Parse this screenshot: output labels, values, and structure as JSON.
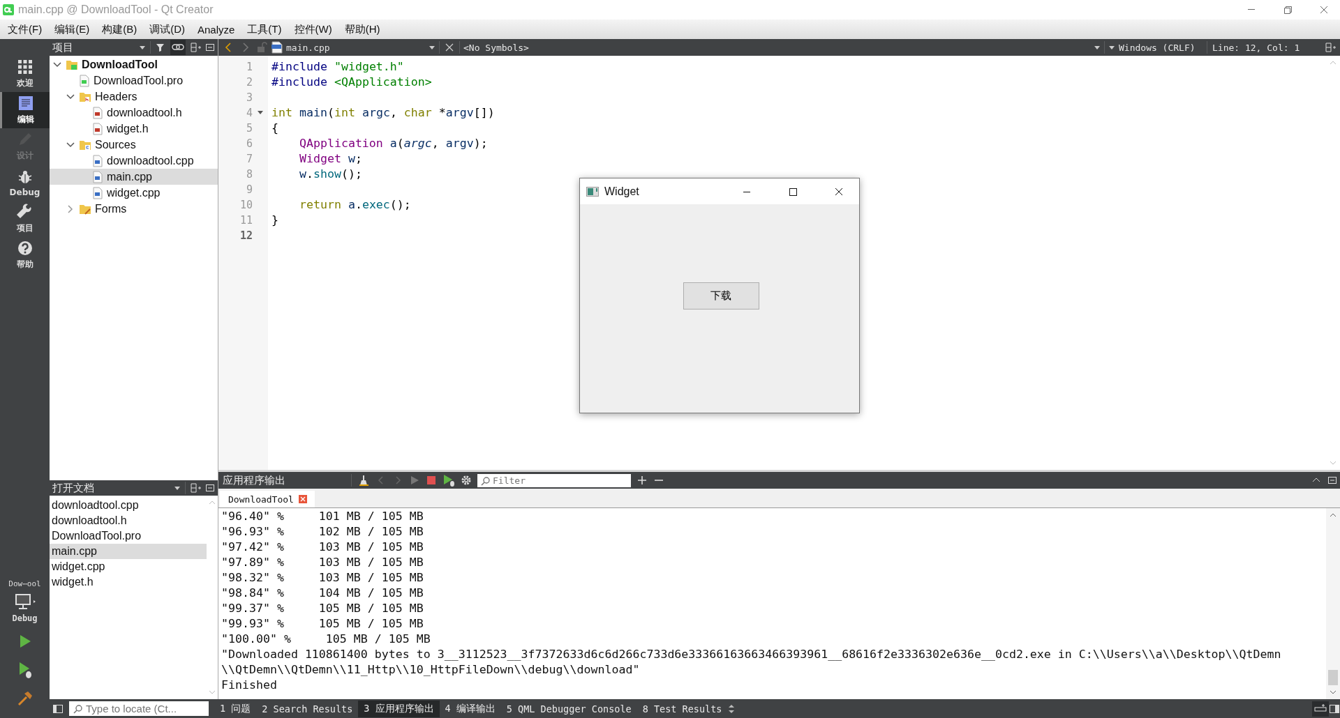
{
  "window": {
    "title": "main.cpp @ DownloadTool - Qt Creator"
  },
  "menu": [
    "文件(F)",
    "编辑(E)",
    "构建(B)",
    "调试(D)",
    "Analyze",
    "工具(T)",
    "控件(W)",
    "帮助(H)"
  ],
  "modes": [
    {
      "label": "欢迎",
      "kind": "welcome",
      "selected": false,
      "disabled": false
    },
    {
      "label": "编辑",
      "kind": "edit",
      "selected": true,
      "disabled": false
    },
    {
      "label": "设计",
      "kind": "design",
      "selected": false,
      "disabled": true
    },
    {
      "label": "Debug",
      "kind": "debug",
      "selected": false,
      "disabled": false
    },
    {
      "label": "项目",
      "kind": "projects",
      "selected": false,
      "disabled": false
    },
    {
      "label": "帮助",
      "kind": "help",
      "selected": false,
      "disabled": false
    }
  ],
  "kit": {
    "project": "Dow⋯ool",
    "build": "Debug"
  },
  "project_panel": {
    "title": "项目",
    "tree": [
      {
        "label": "DownloadTool",
        "kind": "project",
        "expanded": true,
        "selected": false,
        "children": [
          {
            "label": "DownloadTool.pro",
            "kind": "pro",
            "selected": false
          },
          {
            "label": "Headers",
            "kind": "headers",
            "expanded": true,
            "selected": false,
            "children": [
              {
                "label": "downloadtool.h",
                "kind": "header",
                "selected": false
              },
              {
                "label": "widget.h",
                "kind": "header",
                "selected": false
              }
            ]
          },
          {
            "label": "Sources",
            "kind": "sources",
            "expanded": true,
            "selected": false,
            "children": [
              {
                "label": "downloadtool.cpp",
                "kind": "source",
                "selected": false
              },
              {
                "label": "main.cpp",
                "kind": "source",
                "selected": true
              },
              {
                "label": "widget.cpp",
                "kind": "source",
                "selected": false
              }
            ]
          },
          {
            "label": "Forms",
            "kind": "forms",
            "expanded": false,
            "selected": false
          }
        ]
      }
    ]
  },
  "open_documents": {
    "title": "打开文档",
    "items": [
      {
        "label": "downloadtool.cpp",
        "selected": false
      },
      {
        "label": "downloadtool.h",
        "selected": false
      },
      {
        "label": "DownloadTool.pro",
        "selected": false
      },
      {
        "label": "main.cpp",
        "selected": true
      },
      {
        "label": "widget.cpp",
        "selected": false
      },
      {
        "label": "widget.h",
        "selected": false
      }
    ]
  },
  "editor": {
    "file": "main.cpp",
    "symbols": "<No Symbols>",
    "line_ending": "Windows (CRLF)",
    "position": "Line: 12, Col: 1",
    "lines": [
      {
        "number": "1",
        "current": false,
        "tokens": [
          {
            "text": "#include",
            "kind": "preprocessor"
          },
          {
            "text": " \"widget.h\"",
            "kind": "string"
          }
        ]
      },
      {
        "number": "2",
        "current": false,
        "tokens": [
          {
            "text": "#include",
            "kind": "preprocessor"
          },
          {
            "text": " <QApplication>",
            "kind": "string"
          }
        ]
      },
      {
        "number": "3",
        "current": false
      },
      {
        "number": "4",
        "current": false,
        "foldable": true,
        "tokens": [
          {
            "text": "int",
            "kind": "keyword"
          },
          {
            "text": " main",
            "kind": "local"
          },
          {
            "text": "(",
            "kind": "plain"
          },
          {
            "text": "int",
            "kind": "keyword"
          },
          {
            "text": " argc",
            "kind": "local"
          },
          {
            "text": ", ",
            "kind": "plain"
          },
          {
            "text": "char",
            "kind": "keyword"
          },
          {
            "text": " *",
            "kind": "plain"
          },
          {
            "text": "argv",
            "kind": "local"
          },
          {
            "text": "[])",
            "kind": "plain"
          }
        ]
      },
      {
        "number": "5",
        "current": false,
        "tokens": [
          {
            "text": "{",
            "kind": "plain"
          }
        ]
      },
      {
        "number": "6",
        "current": false,
        "tokens": [
          {
            "text": "    QApplication",
            "kind": "type"
          },
          {
            "text": " a",
            "kind": "local"
          },
          {
            "text": "(",
            "kind": "plain"
          },
          {
            "text": "argc",
            "kind": "parameter"
          },
          {
            "text": ", ",
            "kind": "plain"
          },
          {
            "text": "argv",
            "kind": "local"
          },
          {
            "text": ");",
            "kind": "plain"
          }
        ]
      },
      {
        "number": "7",
        "current": false,
        "tokens": [
          {
            "text": "    Widget",
            "kind": "type"
          },
          {
            "text": " w",
            "kind": "local"
          },
          {
            "text": ";",
            "kind": "plain"
          }
        ]
      },
      {
        "number": "8",
        "current": false,
        "tokens": [
          {
            "text": "    w",
            "kind": "local"
          },
          {
            "text": ".",
            "kind": "plain"
          },
          {
            "text": "show",
            "kind": "function"
          },
          {
            "text": "();",
            "kind": "plain"
          }
        ]
      },
      {
        "number": "9",
        "current": false
      },
      {
        "number": "10",
        "current": false,
        "tokens": [
          {
            "text": "    return",
            "kind": "keyword"
          },
          {
            "text": " a",
            "kind": "local"
          },
          {
            "text": ".",
            "kind": "plain"
          },
          {
            "text": "exec",
            "kind": "function"
          },
          {
            "text": "();",
            "kind": "plain"
          }
        ]
      },
      {
        "number": "11",
        "current": false,
        "tokens": [
          {
            "text": "}",
            "kind": "plain"
          }
        ]
      },
      {
        "number": "12",
        "current": true
      }
    ]
  },
  "output": {
    "title": "应用程序输出",
    "filter_placeholder": "Filter",
    "tab": "DownloadTool",
    "lines": [
      "\"96.40\" %     101 MB / 105 MB",
      "\"96.93\" %     102 MB / 105 MB",
      "\"97.42\" %     103 MB / 105 MB",
      "\"97.89\" %     103 MB / 105 MB",
      "\"98.32\" %     103 MB / 105 MB",
      "\"98.84\" %     104 MB / 105 MB",
      "\"99.37\" %     105 MB / 105 MB",
      "\"99.93\" %     105 MB / 105 MB",
      "\"100.00\" %     105 MB / 105 MB",
      "\"Downloaded 110861400 bytes to 3__3112523__3f7372633d6c6d266c733d6e33366163663466393961__68616f2e3336302e636e__0cd2.exe in C:\\\\Users\\\\a\\\\Desktop\\\\QtDemn\\\\QtDemn\\\\QtDemn\\\\11_Http\\\\10_HttpFileDown\\\\debug\\\\download\"",
      "Finished"
    ]
  },
  "status_bar": {
    "locate_placeholder": "Type to locate (Ct...",
    "tabs": [
      {
        "label": "1 问题",
        "selected": false
      },
      {
        "label": "2 Search Results",
        "selected": false
      },
      {
        "label": "3 应用程序输出",
        "selected": true
      },
      {
        "label": "4 编译输出",
        "selected": false
      },
      {
        "label": "5 QML Debugger Console",
        "selected": false
      },
      {
        "label": "8 Test Results",
        "selected": false
      }
    ]
  },
  "widget_window": {
    "title": "Widget",
    "button": "下载"
  }
}
